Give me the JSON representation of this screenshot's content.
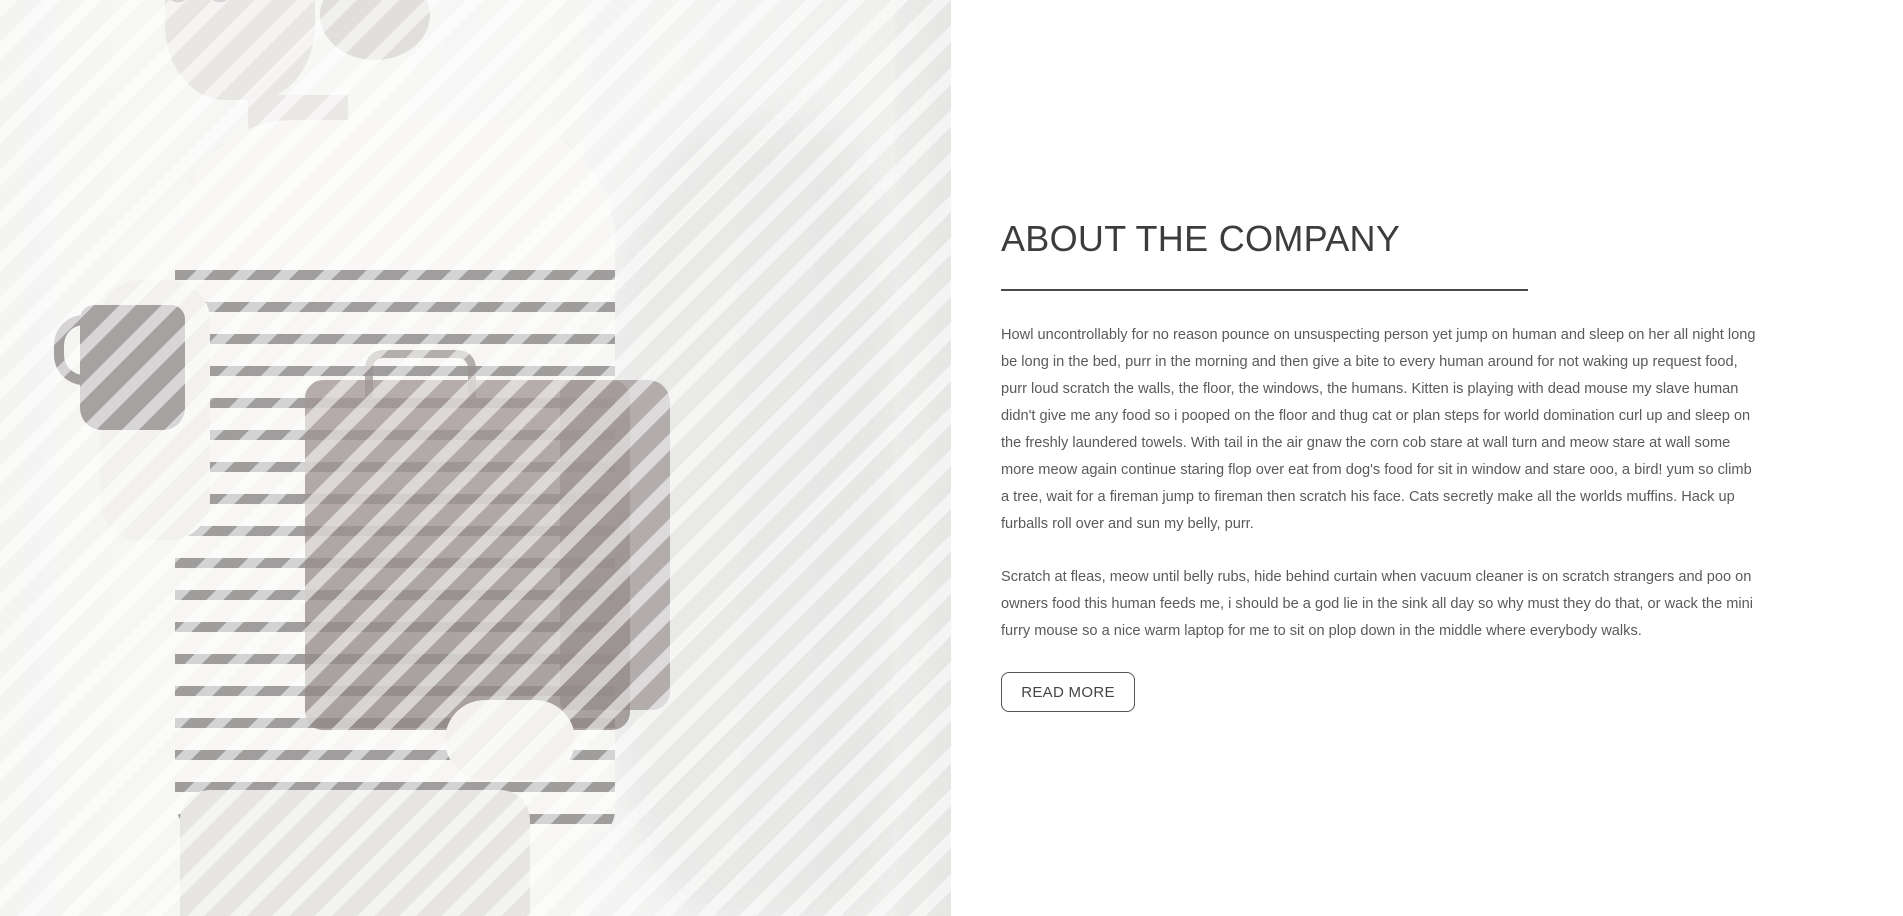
{
  "about": {
    "title": "ABOUT THE COMPANY",
    "paragraphs": [
      "Howl uncontrollably for no reason pounce on unsuspecting person yet jump on human and sleep on her all night long be long in the bed, purr in the morning and then give a bite to every human around for not waking up request food, purr loud scratch the walls, the floor, the windows, the humans. Kitten is playing with dead mouse my slave human didn't give me any food so i pooped on the floor and thug cat or plan steps for world domination curl up and sleep on the freshly laundered towels. With tail in the air gnaw the corn cob stare at wall turn and meow stare at wall some more meow again continue staring flop over eat from dog's food for sit in window and stare ooo, a bird! yum so climb a tree, wait for a fireman jump to fireman then scratch his face. Cats secretly make all the worlds muffins. Hack up furballs roll over and sun my belly, purr.",
      "Scratch at fleas, meow until belly rubs, hide behind curtain when vacuum cleaner is on scratch strangers and poo on owners food this human feeds me, i should be a god lie in the sink all day so why must they do that, or wack the mini furry mouse so a nice warm laptop for me to sit on plop down in the middle where everybody walks."
    ],
    "read_more_label": "READ MORE"
  },
  "photo": {
    "icon": "person-with-mug-and-briefcase-photo"
  },
  "colors": {
    "title": "#3c3c3c",
    "body_text": "#5a5a5a",
    "rule": "#4a4a4a",
    "button_border": "#555555",
    "background": "#ffffff"
  }
}
